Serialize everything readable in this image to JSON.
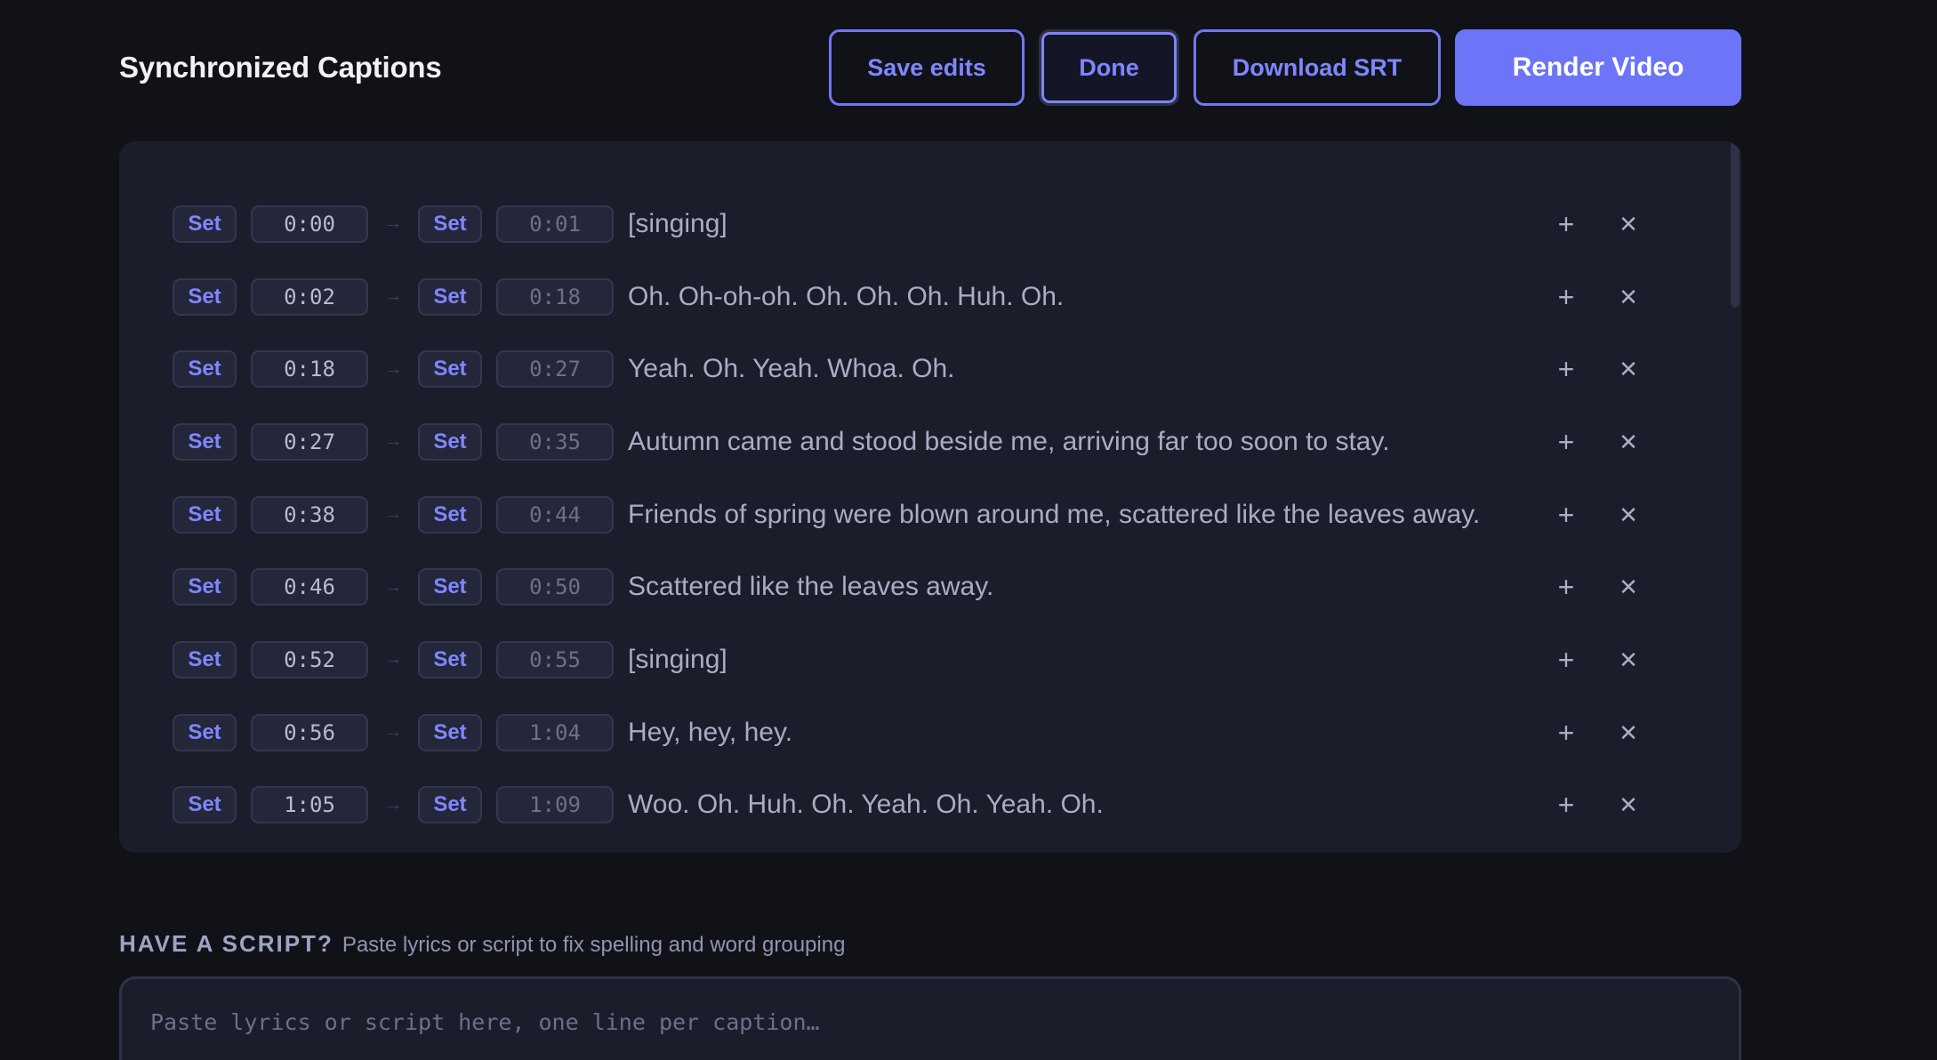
{
  "header": {
    "title": "Synchronized Captions",
    "save_label": "Save edits",
    "done_label": "Done",
    "download_label": "Download SRT",
    "render_label": "Render Video"
  },
  "set_label": "Set",
  "arrow_glyph": "→",
  "captions": [
    {
      "start": "0:00",
      "end": "0:01",
      "text": "[singing]"
    },
    {
      "start": "0:02",
      "end": "0:18",
      "text": "Oh. Oh-oh-oh. Oh. Oh. Oh. Huh. Oh."
    },
    {
      "start": "0:18",
      "end": "0:27",
      "text": "Yeah. Oh. Yeah. Whoa. Oh."
    },
    {
      "start": "0:27",
      "end": "0:35",
      "text": "Autumn came and stood beside me, arriving far too soon to stay."
    },
    {
      "start": "0:38",
      "end": "0:44",
      "text": "Friends of spring were blown around me, scattered like the leaves away."
    },
    {
      "start": "0:46",
      "end": "0:50",
      "text": "Scattered like the leaves away."
    },
    {
      "start": "0:52",
      "end": "0:55",
      "text": "[singing]"
    },
    {
      "start": "0:56",
      "end": "1:04",
      "text": "Hey, hey, hey."
    },
    {
      "start": "1:05",
      "end": "1:09",
      "text": "Woo. Oh. Huh. Oh. Yeah. Oh. Yeah. Oh."
    }
  ],
  "script": {
    "heading": "HAVE A SCRIPT?",
    "hint": "Paste lyrics or script to fix spelling and word grouping",
    "placeholder": "Paste lyrics or script here, one line per caption…"
  },
  "icons": {
    "add": "plus-icon",
    "remove": "close-icon"
  },
  "colors": {
    "background": "#111218",
    "panel": "#1b1d2a",
    "accent": "#6c74f8",
    "accent_text": "#7f86ff"
  }
}
